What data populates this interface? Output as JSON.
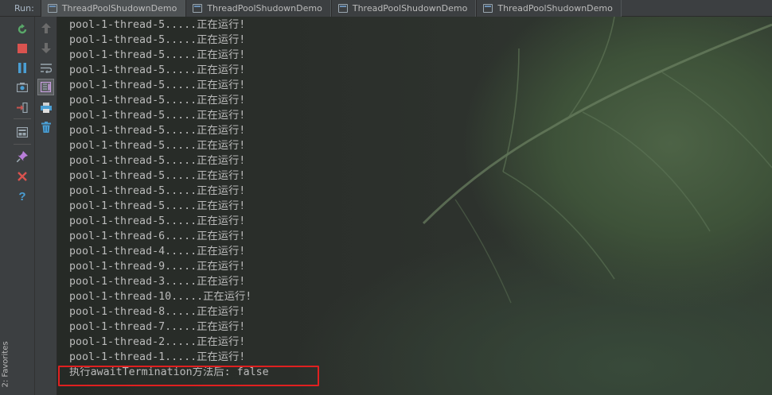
{
  "run_bar": {
    "label": "Run:",
    "tabs": [
      {
        "label": "ThreadPoolShudownDemo",
        "icon": "run-config-icon"
      },
      {
        "label": "ThreadPoolShudownDemo",
        "icon": "run-config-icon"
      },
      {
        "label": "ThreadPoolShudownDemo",
        "icon": "run-config-icon"
      },
      {
        "label": "ThreadPoolShudownDemo",
        "icon": "run-config-icon"
      }
    ]
  },
  "favorites": {
    "label": "2: Favorites",
    "icon": "star-icon"
  },
  "toolbar_left": [
    {
      "name": "rerun-icon",
      "color": "#59a869"
    },
    {
      "name": "stop-icon",
      "color": "#d9534f"
    },
    {
      "name": "pause-icon",
      "color": "#4a9ed3"
    },
    {
      "name": "dump-threads-icon",
      "color": "#9aa7b0"
    },
    {
      "name": "exit-icon",
      "color": "#c75450"
    },
    {
      "name": "restore-layout-icon",
      "color": "#9aa7b0"
    },
    {
      "name": "pin-icon",
      "color": "#b87ed9"
    },
    {
      "name": "close-icon",
      "color": "#d9534f"
    },
    {
      "name": "help-icon",
      "color": "#4a9ed3"
    }
  ],
  "toolbar_right": [
    {
      "name": "up-arrow-icon",
      "color": "#6b6b6b"
    },
    {
      "name": "down-arrow-icon",
      "color": "#6b6b6b"
    },
    {
      "name": "soft-wrap-icon",
      "color": "#9aa7b0"
    },
    {
      "name": "scroll-to-end-icon",
      "color": "#c8a0e0"
    },
    {
      "name": "print-icon",
      "color": "#4a9ed3"
    },
    {
      "name": "clear-all-icon",
      "color": "#4a9ed3"
    }
  ],
  "console": {
    "lines": [
      "pool-1-thread-5.....正在运行!",
      "pool-1-thread-5.....正在运行!",
      "pool-1-thread-5.....正在运行!",
      "pool-1-thread-5.....正在运行!",
      "pool-1-thread-5.....正在运行!",
      "pool-1-thread-5.....正在运行!",
      "pool-1-thread-5.....正在运行!",
      "pool-1-thread-5.....正在运行!",
      "pool-1-thread-5.....正在运行!",
      "pool-1-thread-5.....正在运行!",
      "pool-1-thread-5.....正在运行!",
      "pool-1-thread-5.....正在运行!",
      "pool-1-thread-5.....正在运行!",
      "pool-1-thread-5.....正在运行!",
      "pool-1-thread-6.....正在运行!",
      "pool-1-thread-4.....正在运行!",
      "pool-1-thread-9.....正在运行!",
      "pool-1-thread-3.....正在运行!",
      "pool-1-thread-10.....正在运行!",
      "pool-1-thread-8.....正在运行!",
      "pool-1-thread-7.....正在运行!",
      "pool-1-thread-2.....正在运行!",
      "pool-1-thread-1.....正在运行!"
    ],
    "result_line": "执行awaitTermination方法后: false",
    "highlight_color": "#e02020",
    "text_color": "#bbbbbb"
  }
}
